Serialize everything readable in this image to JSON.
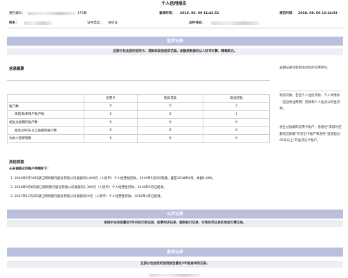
{
  "report": {
    "title": "个人信用报告",
    "report_no_label": "报告编号：",
    "report_no_tail": "175数",
    "query_time_label": "查询时间：",
    "query_time": "2018. 08. 09  11:42:51",
    "report_time_label": "报告时间：",
    "report_time": "2018. 08. 09  16:14:53",
    "name_label": "姓名：",
    "id_type_label": "证件类型：",
    "id_type": "身份证",
    "id_no_label": "证件号码："
  },
  "credit_section": {
    "band": "信贷记录",
    "subtitle": "这部分包含您的信用卡、贷款和其他信贷记录。金额类数据均以人民币计算，精确到元。"
  },
  "summary": {
    "heading": "信息概要",
    "columns": [
      "",
      "信用卡",
      "购房贷款",
      "其他贷款"
    ],
    "rows": [
      {
        "label": "账户数",
        "values": [
          "0",
          "0",
          "3"
        ]
      },
      {
        "label": "未结清/未销户账户数",
        "values": [
          "0",
          "0",
          "1"
        ]
      },
      {
        "label": "发生过逾期的账户数",
        "values": [
          "0",
          "0",
          "0"
        ]
      },
      {
        "label": "发生过90天以上逾期的账户数",
        "values": [
          "0",
          "0",
          "0"
        ]
      },
      {
        "label": "为他人担保笔数",
        "values": [
          "0",
          "0",
          "0"
        ]
      }
    ]
  },
  "side_notes": {
    "note1": "逾期记录可能影响对您的信用评价。",
    "note2": "购房贷款，包括个人住房贷款、个人商用房（包括商住两用）贷款和个人住房公积金贷款。",
    "note3": "发生过逾期的信用卡账户，指曾经“未按时还最低还款额”的贷记卡账户和曾经“透支超过60天以上”的准贷记卡账户。"
  },
  "other_loans": {
    "heading": "其他贷款",
    "subheading": "从未逾期过的账户明细如下：",
    "items": [
      "1.   2018年5月10日浙江网商银行股份有限公司发放的5,000元（人民币）个人经营性贷款，2019年5月9日到期。截至2018年8月，余额1,000。",
      "2.   2018年5月8日浙江网商银行股份有限公司发放的1,300元（人民币）个人经营性贷款，2018年5月已结清。",
      "3.   2017年12月2日浙江网商银行股份有限公司发放的50元（人民币）个人经营性贷款，2018年3月已结清。"
    ]
  },
  "public_section": {
    "band": "公共记录",
    "subtitle": "系统中没有您最近5年内的欠税记录、民事判决记录、强制执行记录、行政处罚记录及电信欠费记录。"
  },
  "query_section": {
    "band": "查询记录",
    "subtitle": "这部分包含您的信用报告最近2年被查询的记录。"
  }
}
